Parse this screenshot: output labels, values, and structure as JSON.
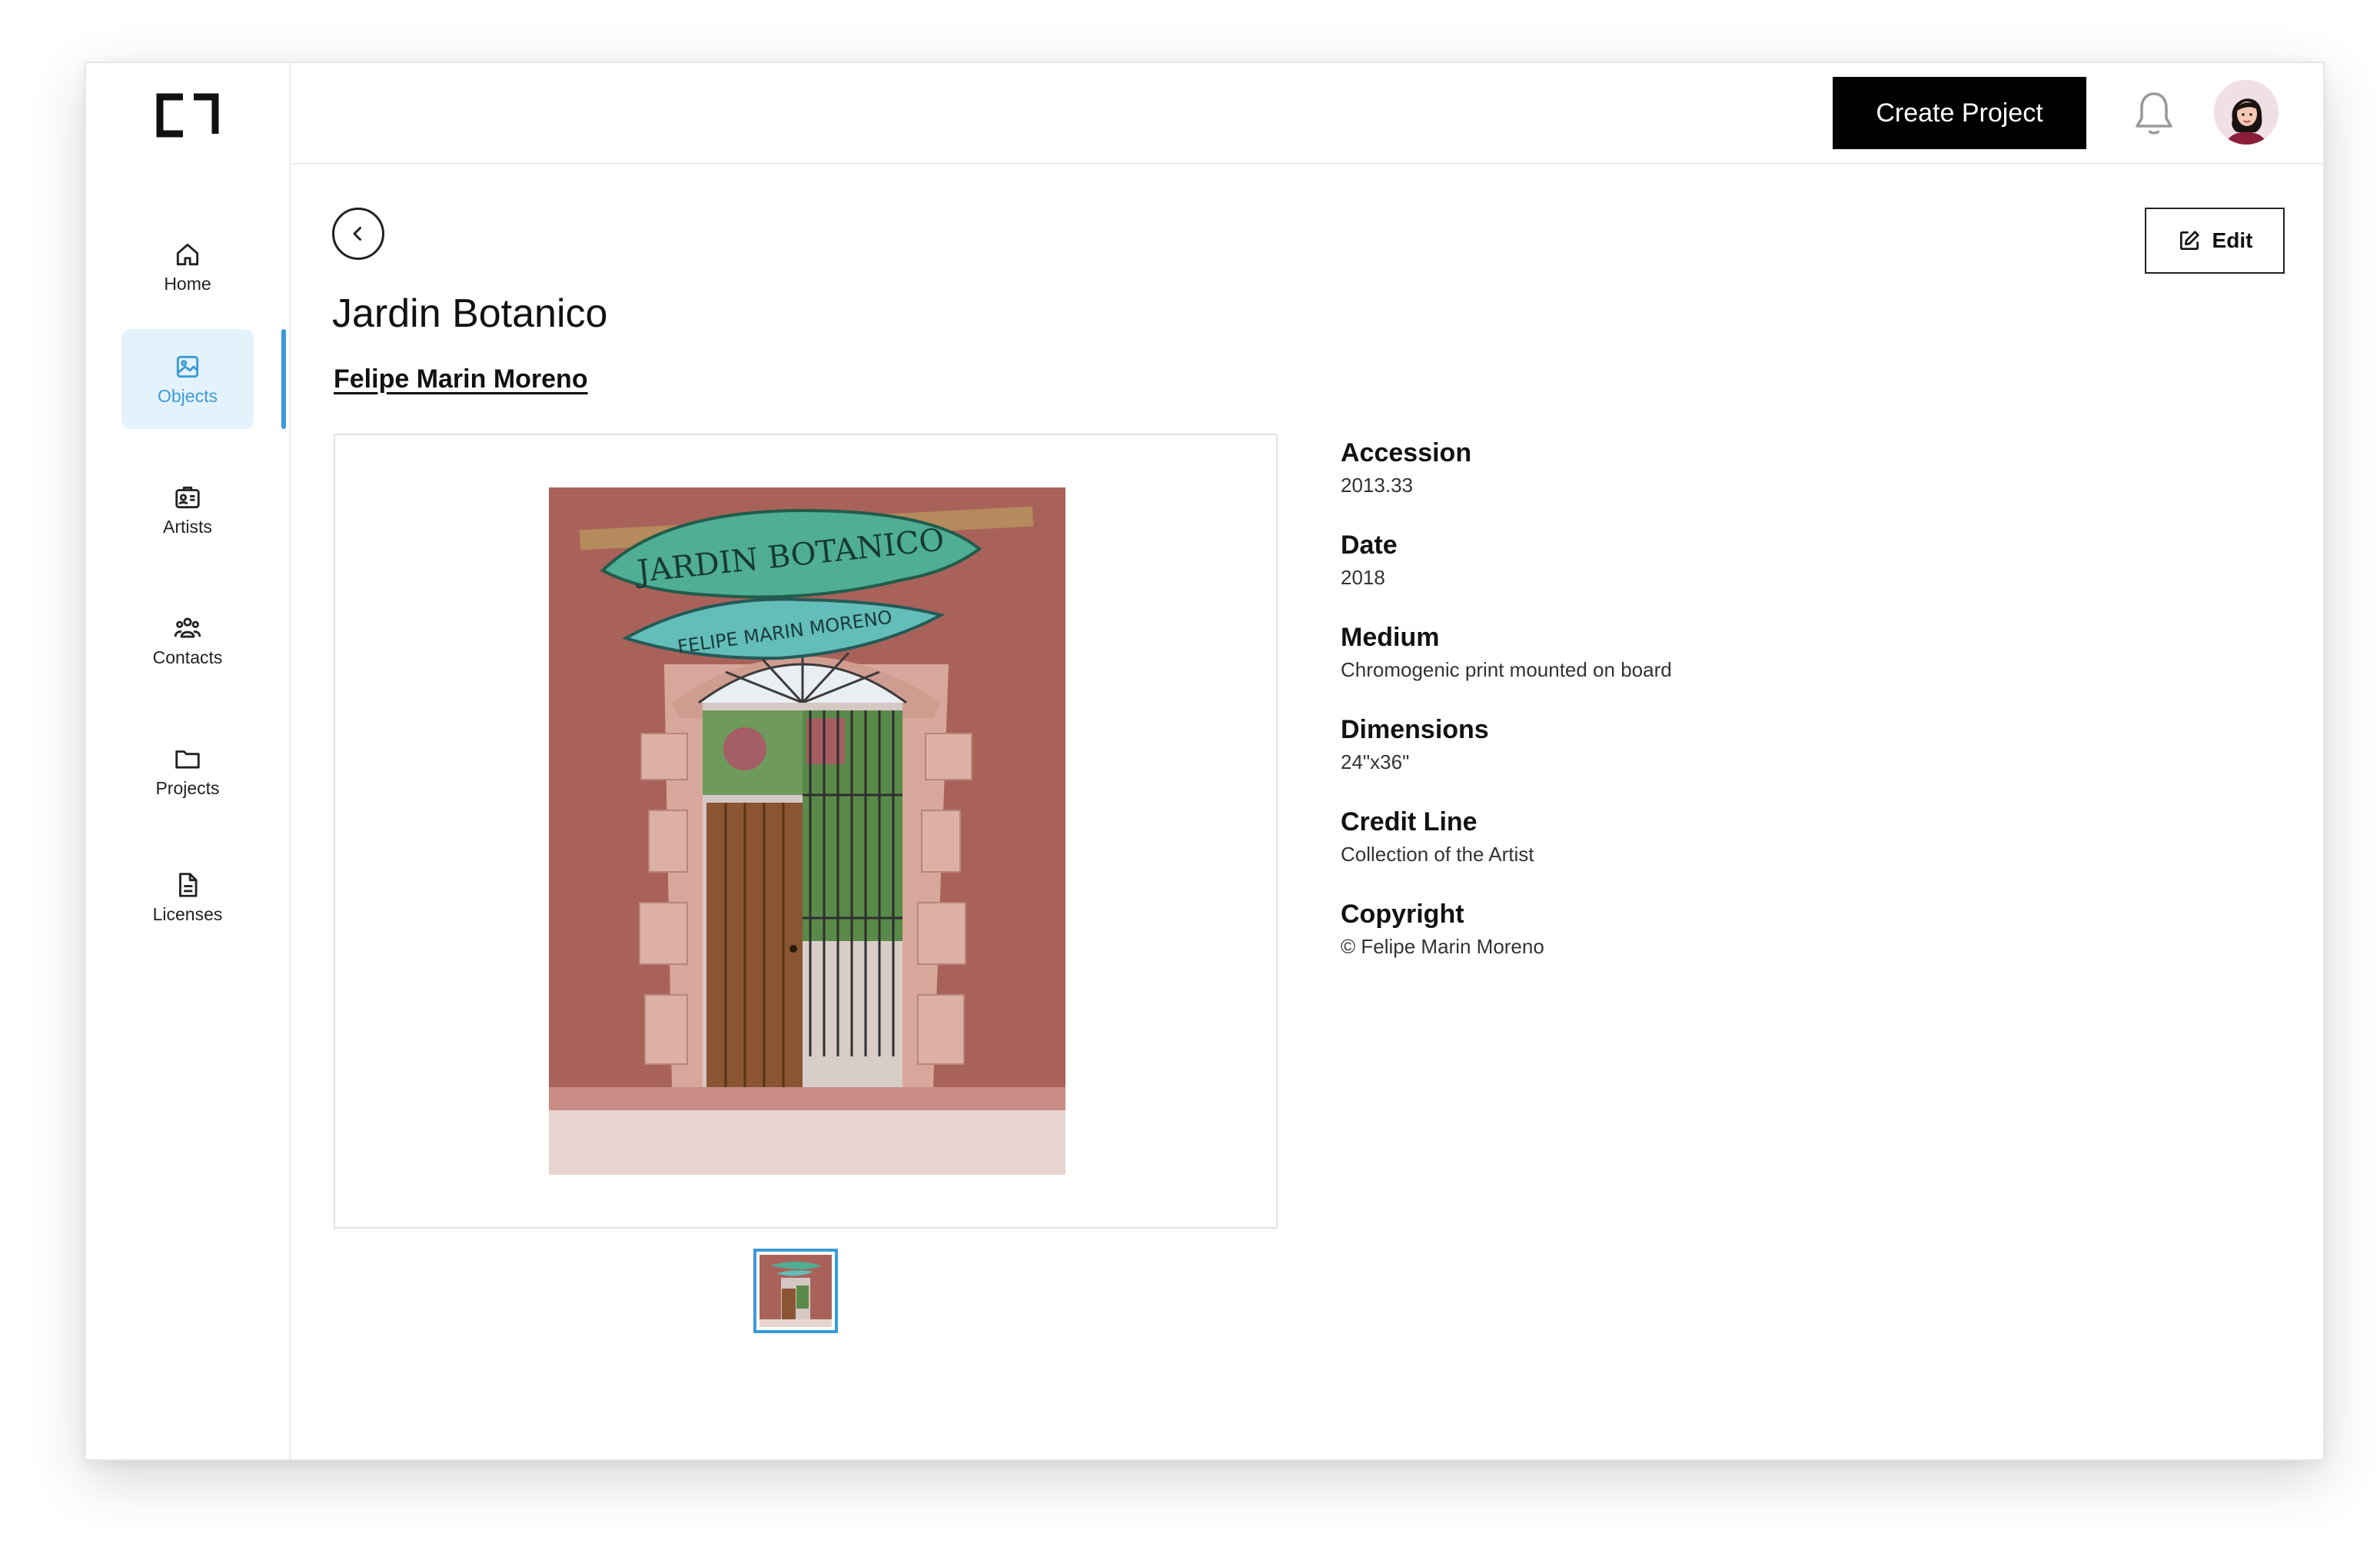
{
  "app": {
    "logo_icon": "bracket-logo-icon",
    "accent_color": "#3a9ad9"
  },
  "sidebar": {
    "items": [
      {
        "label": "Home",
        "icon": "home-icon",
        "active": false
      },
      {
        "label": "Objects",
        "icon": "image-icon",
        "active": true
      },
      {
        "label": "Artists",
        "icon": "id-card-icon",
        "active": false
      },
      {
        "label": "Contacts",
        "icon": "people-icon",
        "active": false
      },
      {
        "label": "Projects",
        "icon": "folder-icon",
        "active": false
      },
      {
        "label": "Licenses",
        "icon": "document-icon",
        "active": false
      }
    ]
  },
  "header": {
    "create_label": "Create Project",
    "bell_icon": "bell-icon",
    "avatar_icon": "user-avatar"
  },
  "object": {
    "title": "Jardin Botanico",
    "artist": "Felipe Marin Moreno",
    "edit_label": "Edit",
    "artwork_sign_top": "JARDIN BOTANICO",
    "artwork_sign_bottom": "FELIPE MARIN MORENO"
  },
  "details": [
    {
      "label": "Accession",
      "value": "2013.33"
    },
    {
      "label": "Date",
      "value": "2018"
    },
    {
      "label": "Medium",
      "value": "Chromogenic print mounted on board"
    },
    {
      "label": "Dimensions",
      "value": "24\"x36\""
    },
    {
      "label": "Credit Line",
      "value": "Collection of the Artist"
    },
    {
      "label": "Copyright",
      "value": "© Felipe Marin Moreno"
    }
  ]
}
